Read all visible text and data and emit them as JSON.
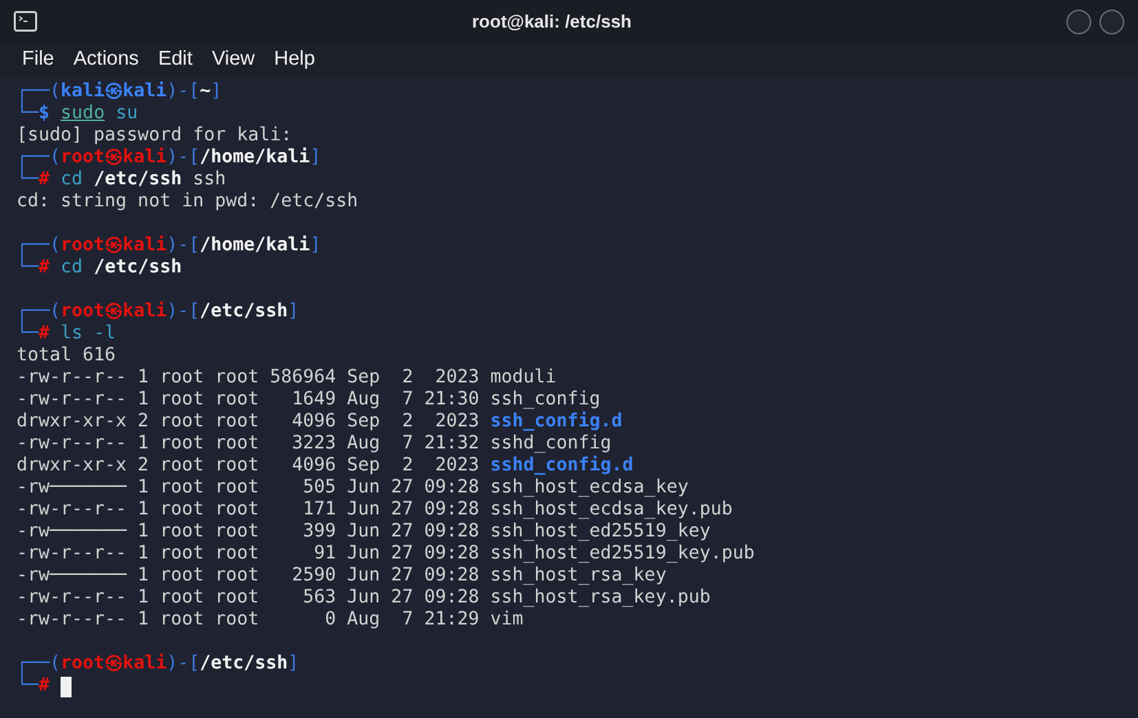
{
  "window": {
    "title": "root@kali: /etc/ssh"
  },
  "menu": [
    "File",
    "Actions",
    "Edit",
    "View",
    "Help"
  ],
  "terminal": {
    "lines": [
      {
        "kind": "prompt",
        "open": "┌──(",
        "user": "kali",
        "at": "㉿",
        "host": "kali",
        "sep": ")-[",
        "path": "~",
        "close": "]",
        "corner": "└─",
        "symbol": "$",
        "privileged": false,
        "tokens": [
          {
            "text": "sudo",
            "kind": "precommand"
          },
          {
            "text": "su",
            "kind": "command"
          }
        ],
        "cursor": false
      },
      {
        "kind": "output",
        "text": "[sudo] password for kali:"
      },
      {
        "kind": "prompt",
        "open": "┌──(",
        "user": "root",
        "at": "㉿",
        "host": "kali",
        "sep": ")-[",
        "path": "/home/kali",
        "close": "]",
        "corner": "└─",
        "symbol": "#",
        "privileged": true,
        "tokens": [
          {
            "text": "cd",
            "kind": "command"
          },
          {
            "text": "/etc/ssh",
            "kind": "path"
          },
          {
            "text": "ssh",
            "kind": "argument"
          }
        ],
        "cursor": false
      },
      {
        "kind": "output",
        "text": "cd: string not in pwd: /etc/ssh"
      },
      {
        "kind": "blank"
      },
      {
        "kind": "prompt",
        "open": "┌──(",
        "user": "root",
        "at": "㉿",
        "host": "kali",
        "sep": ")-[",
        "path": "/home/kali",
        "close": "]",
        "corner": "└─",
        "symbol": "#",
        "privileged": true,
        "tokens": [
          {
            "text": "cd",
            "kind": "command"
          },
          {
            "text": "/etc/ssh",
            "kind": "path"
          }
        ],
        "cursor": false
      },
      {
        "kind": "blank"
      },
      {
        "kind": "prompt",
        "open": "┌──(",
        "user": "root",
        "at": "㉿",
        "host": "kali",
        "sep": ")-[",
        "path": "/etc/ssh",
        "close": "]",
        "corner": "└─",
        "symbol": "#",
        "privileged": true,
        "tokens": [
          {
            "text": "ls",
            "kind": "command"
          },
          {
            "text": "-l",
            "kind": "command"
          }
        ],
        "cursor": false
      },
      {
        "kind": "output",
        "text": "total 616"
      },
      {
        "kind": "entry",
        "meta": "-rw-r--r-- 1 root root 586964 Sep  2  2023",
        "name": "moduli",
        "directory": false
      },
      {
        "kind": "entry",
        "meta": "-rw-r--r-- 1 root root   1649 Aug  7 21:30",
        "name": "ssh_config",
        "directory": false
      },
      {
        "kind": "entry",
        "meta": "drwxr-xr-x 2 root root   4096 Sep  2  2023",
        "name": "ssh_config.d",
        "directory": true
      },
      {
        "kind": "entry",
        "meta": "-rw-r--r-- 1 root root   3223 Aug  7 21:32",
        "name": "sshd_config",
        "directory": false
      },
      {
        "kind": "entry",
        "meta": "drwxr-xr-x 2 root root   4096 Sep  2  2023",
        "name": "sshd_config.d",
        "directory": true
      },
      {
        "kind": "entry",
        "meta": "-rw─────── 1 root root    505 Jun 27 09:28",
        "name": "ssh_host_ecdsa_key",
        "directory": false
      },
      {
        "kind": "entry",
        "meta": "-rw-r--r-- 1 root root    171 Jun 27 09:28",
        "name": "ssh_host_ecdsa_key.pub",
        "directory": false
      },
      {
        "kind": "entry",
        "meta": "-rw─────── 1 root root    399 Jun 27 09:28",
        "name": "ssh_host_ed25519_key",
        "directory": false
      },
      {
        "kind": "entry",
        "meta": "-rw-r--r-- 1 root root     91 Jun 27 09:28",
        "name": "ssh_host_ed25519_key.pub",
        "directory": false
      },
      {
        "kind": "entry",
        "meta": "-rw─────── 1 root root   2590 Jun 27 09:28",
        "name": "ssh_host_rsa_key",
        "directory": false
      },
      {
        "kind": "entry",
        "meta": "-rw-r--r-- 1 root root    563 Jun 27 09:28",
        "name": "ssh_host_rsa_key.pub",
        "directory": false
      },
      {
        "kind": "entry",
        "meta": "-rw-r--r-- 1 root root      0 Aug  7 21:29",
        "name": "vim",
        "directory": false
      },
      {
        "kind": "blank"
      },
      {
        "kind": "prompt",
        "open": "┌──(",
        "user": "root",
        "at": "㉿",
        "host": "kali",
        "sep": ")-[",
        "path": "/etc/ssh",
        "close": "]",
        "corner": "└─",
        "symbol": "#",
        "privileged": true,
        "cursor": true
      }
    ]
  }
}
